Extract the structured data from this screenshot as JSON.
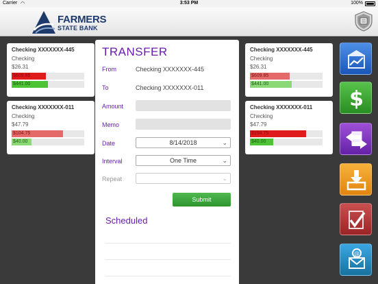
{
  "status_bar": {
    "carrier": "Carrier",
    "wifi": "wifi-icon",
    "time": "3:53 PM",
    "battery": "100%"
  },
  "header": {
    "bank_name_line1": "FARMERS",
    "bank_name_line2": "STATE BANK",
    "logo_icon": "triangle-logo-icon",
    "logout_icon": "shield-logout-icon"
  },
  "accounts_left": [
    {
      "name": "Checking XXXXXXX-445",
      "type": "Checking",
      "balance": "$26.31",
      "bar1": {
        "label": "$609.85",
        "fraction": 0.47,
        "color": "#e01b1b"
      },
      "bar2": {
        "label": "$441.00",
        "fraction": 0.5,
        "color": "#4cc436"
      }
    },
    {
      "name": "Checking XXXXXXX-011",
      "type": "Checking",
      "balance": "$47.79",
      "bar1": {
        "label": "$104.75",
        "fraction": 0.71,
        "color": "#e46a6a"
      },
      "bar2": {
        "label": "$40.00",
        "fraction": 0.27,
        "color": "#8bd976"
      }
    }
  ],
  "accounts_right": [
    {
      "name": "Checking XXXXXXX-445",
      "type": "Checking",
      "balance": "$26.31",
      "bar1": {
        "label": "$609.85",
        "fraction": 0.55,
        "color": "#e46a6a"
      },
      "bar2": {
        "label": "$441.00",
        "fraction": 0.58,
        "color": "#8bd976"
      }
    },
    {
      "name": "Checking XXXXXXX-011",
      "type": "Checking",
      "balance": "$47.79",
      "bar1": {
        "label": "$104.75",
        "fraction": 0.77,
        "color": "#e01b1b"
      },
      "bar2": {
        "label": "$40.00",
        "fraction": 0.32,
        "color": "#4cc436"
      }
    }
  ],
  "transfer": {
    "title": "TRANSFER",
    "from_label": "From",
    "from_value": "Checking XXXXXXX-445",
    "to_label": "To",
    "to_value": "Checking XXXXXXX-011",
    "amount_label": "Amount",
    "amount_value": "",
    "memo_label": "Memo",
    "memo_value": "",
    "date_label": "Date",
    "date_value": "8/14/2018",
    "interval_label": "Interval",
    "interval_value": "One Time",
    "repeat_label": "Repeat",
    "repeat_value": "",
    "submit_label": "Submit",
    "scheduled_label": "Scheduled"
  },
  "nav": [
    {
      "name": "accounts-chart-icon",
      "color": "#1a56b8"
    },
    {
      "name": "dollar-icon",
      "color": "#2a8e23"
    },
    {
      "name": "transfer-arrows-icon",
      "color": "#6422a5"
    },
    {
      "name": "deposit-tray-icon",
      "color": "#e08510"
    },
    {
      "name": "bill-pay-check-icon",
      "color": "#9b2424"
    },
    {
      "name": "contact-phone-icon",
      "color": "#17729f"
    }
  ]
}
